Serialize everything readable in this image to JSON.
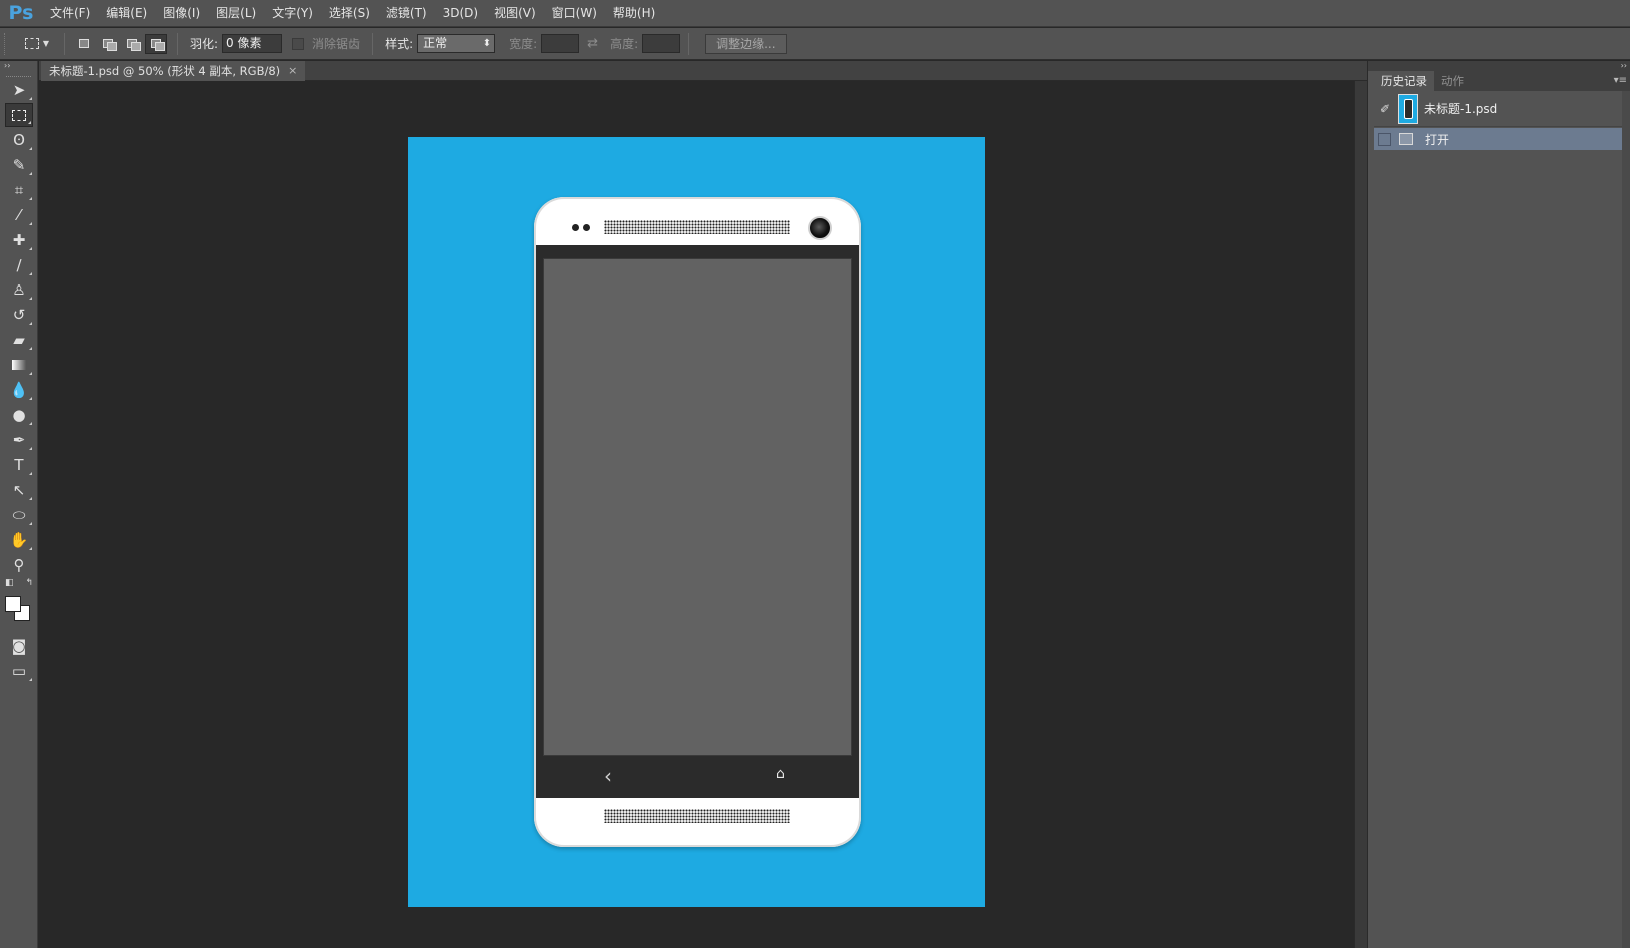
{
  "app": {
    "logo": "Ps"
  },
  "menu": [
    "文件(F)",
    "编辑(E)",
    "图像(I)",
    "图层(L)",
    "文字(Y)",
    "选择(S)",
    "滤镜(T)",
    "3D(D)",
    "视图(V)",
    "窗口(W)",
    "帮助(H)"
  ],
  "options": {
    "feather_label": "羽化:",
    "feather_value": "0 像素",
    "antialias_label": "消除锯齿",
    "style_label": "样式:",
    "style_value": "正常",
    "width_label": "宽度:",
    "height_label": "高度:",
    "refine_edge_label": "调整边缘..."
  },
  "document": {
    "tab_title": "未标题-1.psd @ 50% (形状 4 副本, RGB/8)",
    "tab_close": "×",
    "canvas_color": "#1eaae2"
  },
  "tools": [
    "move-tool",
    "rect-marquee-tool",
    "lasso-tool",
    "quick-select-tool",
    "crop-tool",
    "eyedropper-tool",
    "healing-brush-tool",
    "brush-tool",
    "clone-stamp-tool",
    "history-brush-tool",
    "eraser-tool",
    "gradient-tool",
    "blur-tool",
    "dodge-tool",
    "pen-tool",
    "type-tool",
    "path-select-tool",
    "ellipse-tool",
    "hand-tool",
    "zoom-tool"
  ],
  "panel": {
    "tabs": [
      "历史记录",
      "动作"
    ],
    "snapshot_name": "未标题-1.psd",
    "step_name": "打开"
  }
}
